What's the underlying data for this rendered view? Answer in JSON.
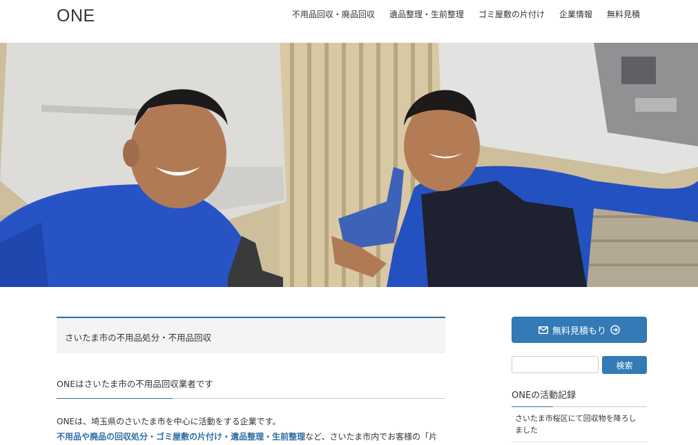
{
  "header": {
    "logo": "ONE",
    "nav": [
      "不用品回収・廃品回収",
      "遺品整理・生前整理",
      "ゴミ屋敷の片付け",
      "企業情報",
      "無料見積"
    ]
  },
  "main": {
    "section_title": "さいたま市の不用品処分・不用品回収",
    "entry_heading": "ONEはさいたま市の不用品回収業者です",
    "paragraph_line1": "ONEは、埼玉県のさいたま市を中心に活動をする企業です。",
    "links": [
      "不用品や廃品の回収処分",
      "ゴミ屋敷の片付け",
      "遺品整理",
      "生前整理"
    ],
    "separator": "・",
    "paragraph_line2_suffix": "など、さいたま市内でお客様の「片"
  },
  "sidebar": {
    "cta_label": "無料見積もり",
    "search_placeholder": "",
    "search_button": "検索",
    "widget_title": "ONEの活動記録",
    "posts": [
      "さいたま市桜区にて回収物を降ろしました"
    ]
  },
  "colors": {
    "accent": "#337ab7",
    "link": "#2e6da4"
  }
}
